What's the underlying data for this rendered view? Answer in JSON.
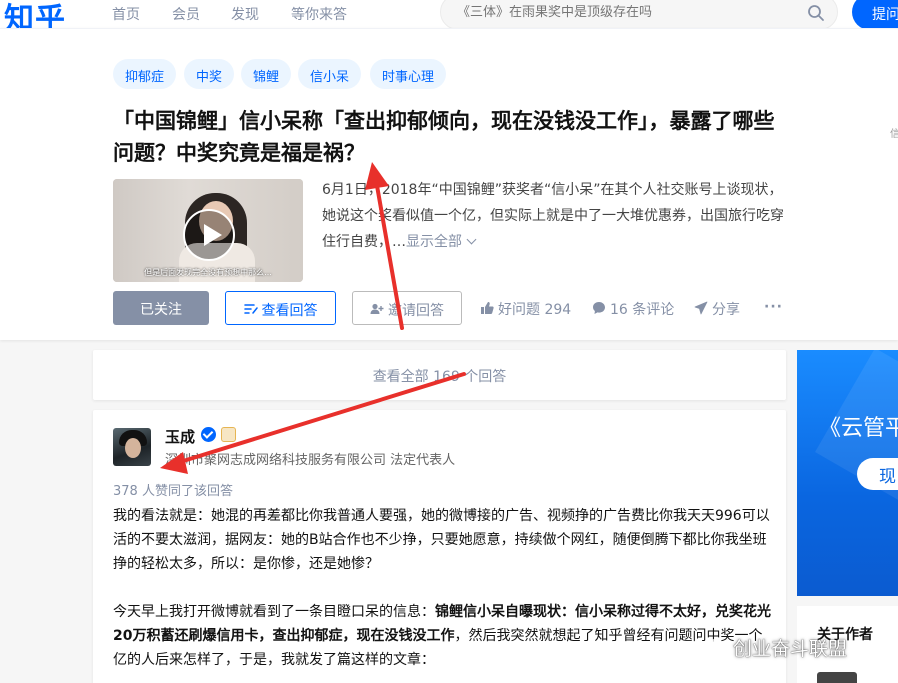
{
  "header": {
    "logo": "知乎",
    "nav": [
      "首页",
      "会员",
      "发现",
      "等你来答"
    ],
    "search_placeholder": "《三体》在雨果奖中是顶级存在吗",
    "ask_label": "提问"
  },
  "question": {
    "tags": [
      "抑郁症",
      "中奖",
      "锦鲤",
      "信小呆",
      "时事心理"
    ],
    "title": "「中国锦鲤」信小呆称「查出抑郁倾向，现在没钱没工作」，暴露了哪些问题？中奖究竟是福是祸？",
    "thumb_caption": "但是后面发现完全没有预想中那么...",
    "excerpt": "6月1日，2018年“中国锦鲤”获奖者“信小呆”在其个人社交账号上谈现状，她说这个奖看似值一个亿，但实际上就是中了一大堆优惠券，出国旅行吃穿住行自费，…",
    "show_all": "显示全部",
    "follow_label": "已关注",
    "view_answers_label": "查看回答",
    "invite_label": "邀请回答",
    "upvote_label": "好问题 294",
    "comment_label": "16 条评论",
    "share_label": "分享",
    "more_label": "···",
    "right_edge_text": "信"
  },
  "answers": {
    "view_all": "查看全部 169 个回答"
  },
  "answer": {
    "author_name": "玉成",
    "author_desc": "深圳市聚网志成网络科技服务有限公司 法定代表人",
    "votes": "378 人赞同了该回答",
    "p1": "我的看法就是：她混的再差都比你我普通人要强，她的微博接的广告、视频挣的广告费比你我天天996可以活的不要太滋润，据网友：她的B站合作也不少挣，只要她愿意，持续做个网红，随便倒腾下都比你我坐班挣的轻松太多，所以：是你惨，还是她惨？",
    "p2_a": "今天早上我打开微博就看到了一条目瞪口呆的信息：",
    "p2_b": "锦鲤信小呆自曝现状：信小呆称过得不太好，兑奖花光20万积蓄还刷爆信用卡，查出抑郁症，现在没钱没工作",
    "p2_c": "，然后我突然就想起了知乎曾经有问题问中奖一个亿的人后来怎样了，于是，我就发了篇这样的文章："
  },
  "sidebar": {
    "ad_title": "《云管平",
    "ad_button": "现",
    "about_title": "关于作者"
  },
  "watermark": "创业奋斗联盟",
  "colors": {
    "brand": "#0066ff",
    "annotation": "#e8302b"
  }
}
